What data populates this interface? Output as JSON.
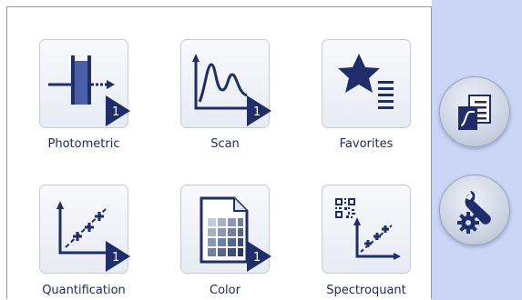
{
  "tiles": [
    {
      "label": "Photometric",
      "badge": "1",
      "icon": "photometric-icon"
    },
    {
      "label": "Scan",
      "badge": "1",
      "icon": "scan-icon"
    },
    {
      "label": "Favorites",
      "icon": "favorites-icon"
    },
    {
      "label": "Quantification",
      "badge": "1",
      "icon": "quantification-icon"
    },
    {
      "label": "Color",
      "badge": "1",
      "icon": "color-icon"
    },
    {
      "label": "Spectroquant",
      "icon": "spectroquant-icon"
    }
  ],
  "sidebar": {
    "buttons": [
      {
        "icon": "method-document-icon"
      },
      {
        "icon": "settings-wrench-icon"
      }
    ]
  },
  "colors": {
    "icon_dark": "#1f2d6b",
    "icon_mid": "#4a5fa8",
    "sidebar_bg": "#cbd6f7",
    "label_text": "#1a2a55"
  }
}
